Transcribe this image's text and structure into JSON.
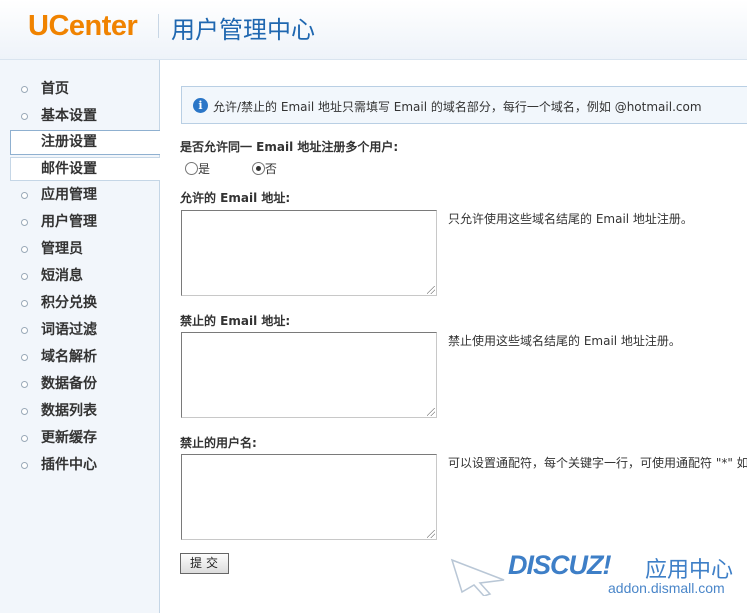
{
  "header": {
    "logo_u": "U",
    "logo_rest": "Center",
    "title": "用户管理中心"
  },
  "sidebar": {
    "items": [
      {
        "label": "首页"
      },
      {
        "label": "基本设置"
      },
      {
        "label": "注册设置"
      },
      {
        "label": "邮件设置"
      },
      {
        "label": "应用管理"
      },
      {
        "label": "用户管理"
      },
      {
        "label": "管理员"
      },
      {
        "label": "短消息"
      },
      {
        "label": "积分兑换"
      },
      {
        "label": "词语过滤"
      },
      {
        "label": "域名解析"
      },
      {
        "label": "数据备份"
      },
      {
        "label": "数据列表"
      },
      {
        "label": "更新缓存"
      },
      {
        "label": "插件中心"
      }
    ]
  },
  "main": {
    "info_text": "允许/禁止的 Email 地址只需填写 Email 的域名部分，每行一个域名，例如 @hotmail.com",
    "multi_user": {
      "title": "是否允许同一 Email 地址注册多个用户:",
      "option_yes": "是",
      "option_no": "否",
      "selected": "否"
    },
    "allowed_email": {
      "title": "允许的 Email 地址:",
      "value": "",
      "hint": "只允许使用这些域名结尾的 Email 地址注册。"
    },
    "banned_email": {
      "title": "禁止的 Email 地址:",
      "value": "",
      "hint": "禁止使用这些域名结尾的 Email 地址注册。"
    },
    "banned_username": {
      "title": "禁止的用户名:",
      "value": "",
      "hint": "可以设置通配符，每个关键字一行，可使用通配符 \"*\" 如"
    },
    "submit_label": "提交"
  },
  "watermark": {
    "brand": "DISCUZ!",
    "brand_cn": "应用中心",
    "url": "addon.dismall.com"
  },
  "colors": {
    "accent": "#1f67b0",
    "logo_orange": "#f08300",
    "sidebar_bg": "#f2f6fb"
  }
}
